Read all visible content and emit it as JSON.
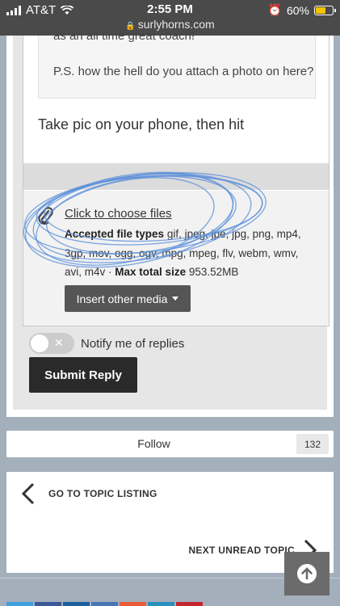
{
  "status_bar": {
    "carrier": "AT&T",
    "time": "2:55 PM",
    "url": "surlyhorns.com",
    "battery": "60%",
    "battery_level": 0.6
  },
  "editor": {
    "quote_line1": "as an all time great coach!",
    "quote_line2": "P.S. how the hell do you attach a photo on here?",
    "reply_text": "Take pic on your phone, then hit"
  },
  "attachments": {
    "choose_files_label": "Click to choose files",
    "accepted_label": "Accepted file types",
    "accepted_types": "gif, jpeg, jpe, jpg, png, mp4, 3gp, mov, ogg, ogv, mpg, mpeg, flv, webm, wmv, avi, m4v",
    "separator": "·",
    "max_size_label": "Max total size",
    "max_size_value": "953.52MB",
    "insert_media_label": "Insert other media"
  },
  "notify": {
    "label": "Notify me of replies",
    "enabled": false
  },
  "submit_label": "Submit Reply",
  "follow": {
    "label": "Follow",
    "count": "132"
  },
  "topic_nav": {
    "prev_label": "GO TO TOPIC LISTING",
    "next_label": "NEXT UNREAD TOPIC"
  },
  "colors": {
    "status_bar": "#4a4a4a",
    "page_bg": "#a3afbb",
    "submit_button": "#2a2a2a",
    "insert_button": "#555555",
    "scribble": "#5b8fd9",
    "battery": "#f5c400"
  },
  "share_colors": [
    "#3fa0e0",
    "#3b5998",
    "#1f5f9e",
    "#4875b4",
    "#e95c37",
    "#2a8fbd",
    "#c4262e"
  ]
}
